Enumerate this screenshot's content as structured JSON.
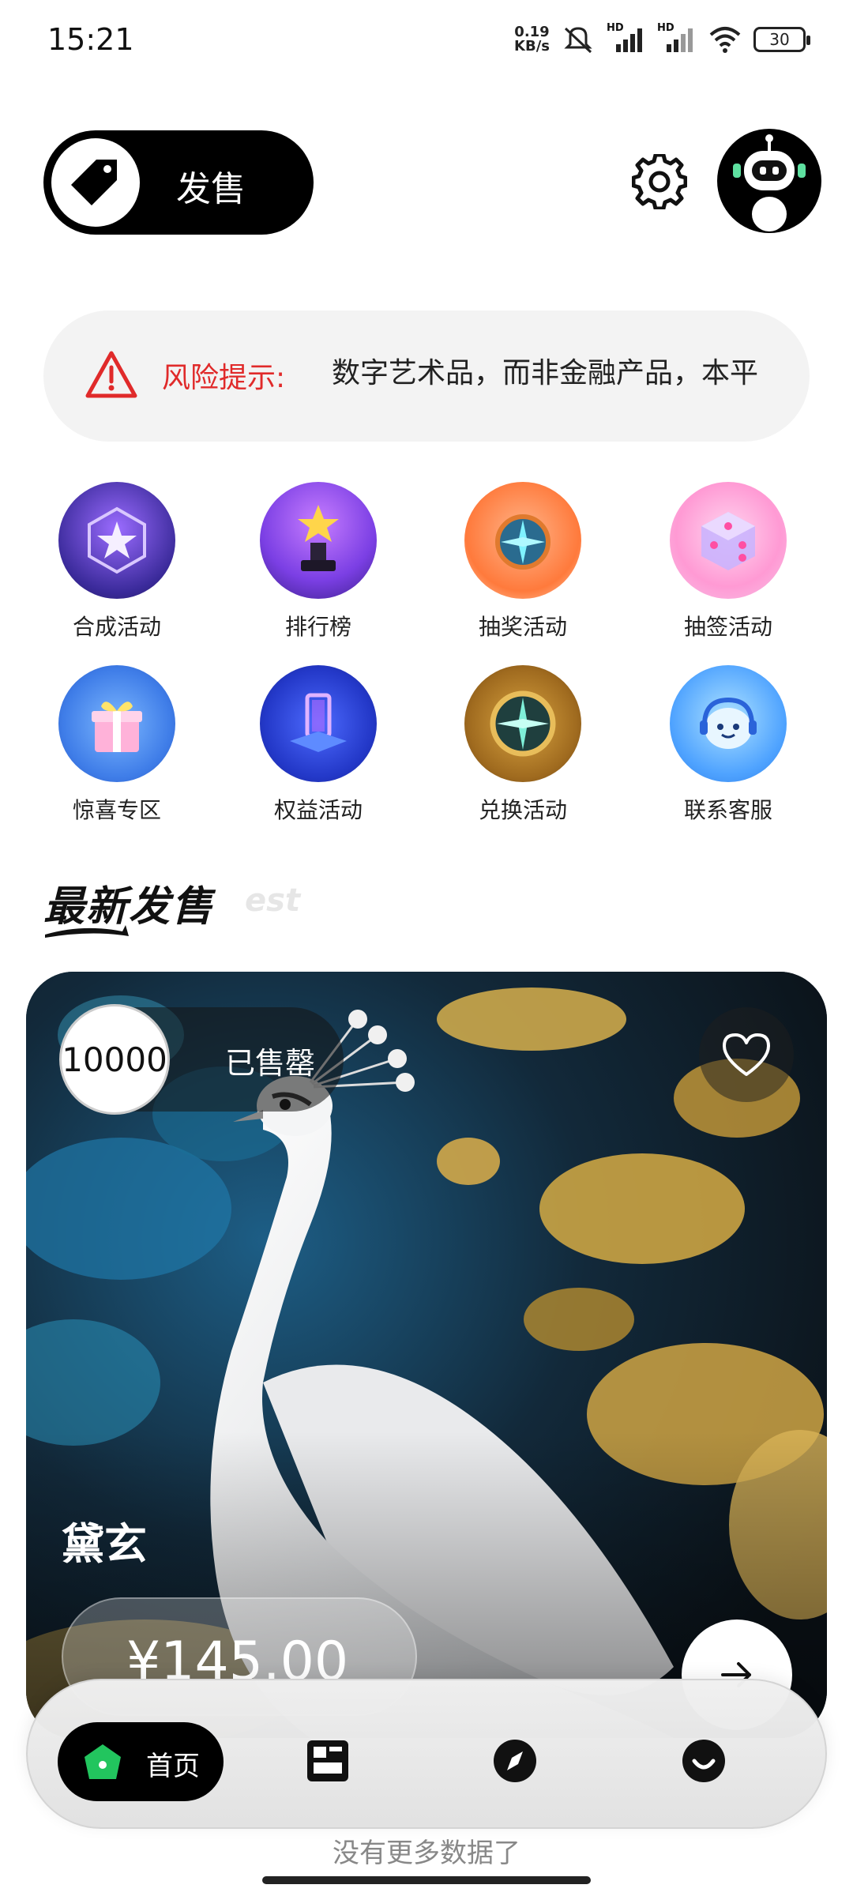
{
  "status_bar": {
    "time": "15:21",
    "net_speed_value": "0.19",
    "net_speed_unit": "KB/s",
    "sim1": "HD",
    "sim2": "HD",
    "battery": "30"
  },
  "header": {
    "sell_label": "发售",
    "icons": [
      "tag-icon",
      "gear-icon",
      "robot-avatar"
    ]
  },
  "risk_notice": {
    "label": "风险提示:",
    "text": "数字艺术品，而非金融产品，本平"
  },
  "quick_links": [
    {
      "label": "合成活动",
      "icon": "star-crystal-icon"
    },
    {
      "label": "排行榜",
      "icon": "trophy-icon"
    },
    {
      "label": "抽奖活动",
      "icon": "compass-orb-icon"
    },
    {
      "label": "抽签活动",
      "icon": "dice-icon"
    },
    {
      "label": "惊喜专区",
      "icon": "gift-box-icon"
    },
    {
      "label": "权益活动",
      "icon": "portal-icon"
    },
    {
      "label": "兑换活动",
      "icon": "gold-compass-icon"
    },
    {
      "label": "联系客服",
      "icon": "support-bot-icon"
    }
  ],
  "section": {
    "title": "最新发售",
    "subtitle": "est"
  },
  "product": {
    "count": "10000",
    "status": "已售罄",
    "name": "黛玄",
    "price": "¥145.00"
  },
  "bottom_nav": {
    "home_label": "首页",
    "items": [
      "home-icon",
      "market-icon",
      "discover-icon",
      "profile-icon"
    ],
    "accent": "#22c55e"
  },
  "footer": {
    "no_more": "没有更多数据了"
  }
}
